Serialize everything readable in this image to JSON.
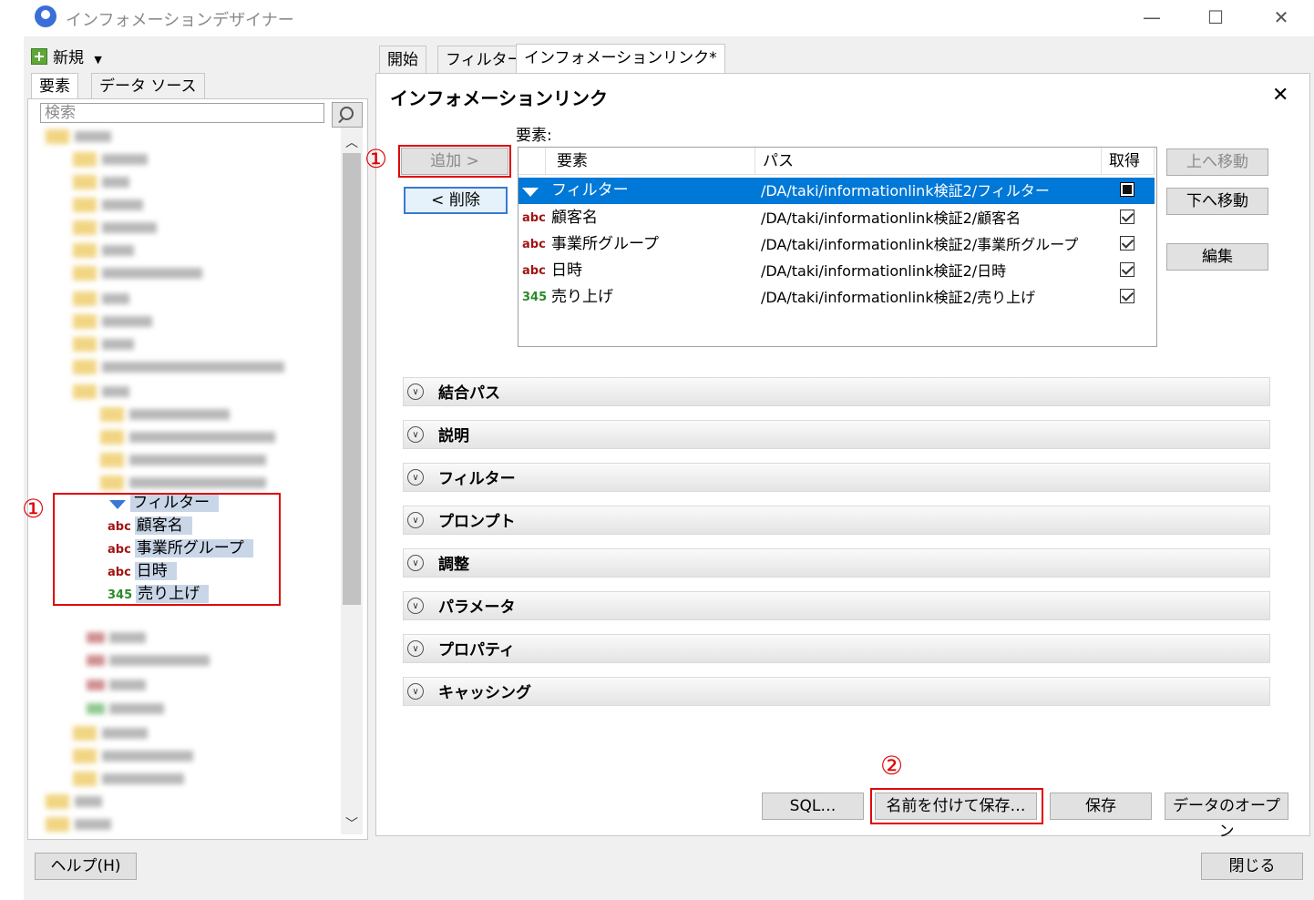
{
  "window": {
    "title": "インフォメーションデザイナー",
    "controls": [
      "—",
      "☐",
      "✕"
    ]
  },
  "left": {
    "new_label": "新規",
    "tabs": [
      "要素",
      "データ ソース"
    ],
    "search_placeholder": "検索",
    "tree_items": [
      {
        "type": "filter",
        "label": "フィルター"
      },
      {
        "type": "abc",
        "label": "顧客名"
      },
      {
        "type": "abc",
        "label": "事業所グループ"
      },
      {
        "type": "abc",
        "label": "日時"
      },
      {
        "type": "345",
        "label": "売り上げ"
      }
    ],
    "annotation": "①"
  },
  "tabs": [
    "開始",
    "フィルター",
    "インフォメーションリンク*"
  ],
  "main": {
    "title": "インフォメーションリンク",
    "close": "✕",
    "elements_label": "要素:",
    "add_button": "追加 >",
    "remove_button": "< 削除",
    "annotation_add": "①",
    "move_up_button": "上へ移動",
    "move_down_button": "下へ移動",
    "edit_button": "編集",
    "columns": [
      "要素",
      "パス",
      "取得"
    ],
    "rows": [
      {
        "type": "filter",
        "name": "フィルター",
        "path": "/DA/taki/informationlink検証2/フィルター",
        "state": "filled",
        "selected": true
      },
      {
        "type": "abc",
        "name": "顧客名",
        "path": "/DA/taki/informationlink検証2/顧客名",
        "state": "checked",
        "selected": false
      },
      {
        "type": "abc",
        "name": "事業所グループ",
        "path": "/DA/taki/informationlink検証2/事業所グループ",
        "state": "checked",
        "selected": false
      },
      {
        "type": "abc",
        "name": "日時",
        "path": "/DA/taki/informationlink検証2/日時",
        "state": "checked",
        "selected": false
      },
      {
        "type": "345",
        "name": "売り上げ",
        "path": "/DA/taki/informationlink検証2/売り上げ",
        "state": "checked",
        "selected": false
      }
    ],
    "sections": [
      "結合パス",
      "説明",
      "フィルター",
      "プロンプト",
      "調整",
      "パラメータ",
      "プロパティ",
      "キャッシング"
    ],
    "sql_button": "SQL…",
    "save_as_button": "名前を付けて保存…",
    "annotation_save": "②",
    "save_button": "保存",
    "open_data_button": "データのオープン"
  },
  "footer": {
    "help_button": "ヘルプ(H)",
    "close_button": "閉じる"
  },
  "type_labels": {
    "abc": "abc",
    "345": "345"
  }
}
